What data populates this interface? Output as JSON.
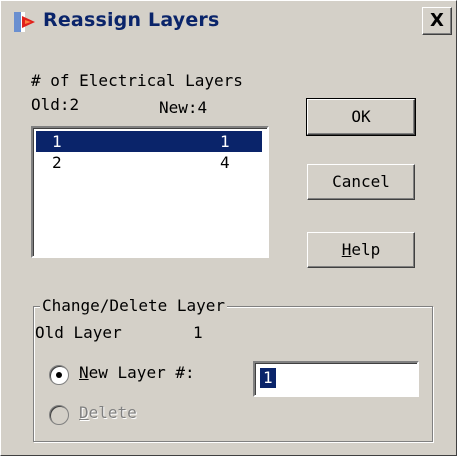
{
  "window": {
    "title": "Reassign Layers",
    "close_label": "X"
  },
  "layers": {
    "heading": "# of Electrical Layers",
    "old_label": "Old:2",
    "new_label": "New:4",
    "rows": [
      {
        "old": "1",
        "new": "1",
        "selected": true
      },
      {
        "old": "2",
        "new": "4",
        "selected": false
      }
    ]
  },
  "buttons": {
    "ok": "OK",
    "cancel": "Cancel",
    "help_mnemonic": "H",
    "help_rest": "elp"
  },
  "change_group": {
    "title": "Change/Delete Layer",
    "old_layer_label": "Old Layer",
    "old_layer_value": "1",
    "new_layer_mnemonic": "N",
    "new_layer_rest": "ew Layer #:",
    "new_layer_value": "1",
    "delete_mnemonic": "D",
    "delete_rest": "elete",
    "new_layer_selected": true,
    "delete_enabled": false
  },
  "colors": {
    "face": "#d4d0c8",
    "selection": "#0a246a",
    "title_text": "#0a246a"
  }
}
